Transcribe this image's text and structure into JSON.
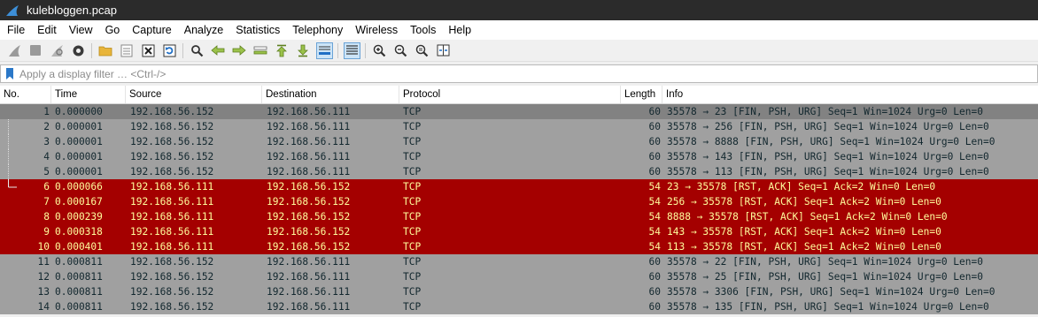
{
  "window": {
    "title": "kulebloggen.pcap",
    "app_icon": "wireshark-fin-icon"
  },
  "menu": [
    "File",
    "Edit",
    "View",
    "Go",
    "Capture",
    "Analyze",
    "Statistics",
    "Telephony",
    "Wireless",
    "Tools",
    "Help"
  ],
  "toolbar": {
    "icons": [
      "start-capture-icon",
      "stop-capture-icon",
      "restart-capture-icon",
      "capture-options-icon",
      "open-file-icon",
      "save-file-icon",
      "close-file-icon",
      "reload-file-icon",
      "find-packet-icon",
      "go-back-icon",
      "go-forward-icon",
      "go-to-packet-icon",
      "go-first-packet-icon",
      "go-last-packet-icon",
      "auto-scroll-icon",
      "colorize-icon",
      "zoom-in-icon",
      "zoom-out-icon",
      "normal-size-icon",
      "resize-columns-icon"
    ]
  },
  "filter": {
    "placeholder": "Apply a display filter … <Ctrl-/>",
    "value": ""
  },
  "columns": [
    "No.",
    "Time",
    "Source",
    "Destination",
    "Protocol",
    "Length",
    "Info"
  ],
  "colors": {
    "tcp_gray": "#a0a0a0",
    "tcp_gray_text": "#12272e",
    "rst_red": "#a40000",
    "rst_red_text": "#fffc9c",
    "selected_gray": "#828282"
  },
  "packets": [
    {
      "no": "1",
      "time": "0.000000",
      "src": "192.168.56.152",
      "dst": "192.168.56.111",
      "proto": "TCP",
      "len": "60",
      "info": "35578 → 23 [FIN, PSH, URG] Seq=1 Win=1024 Urg=0 Len=0",
      "color": "gray",
      "selected": true
    },
    {
      "no": "2",
      "time": "0.000001",
      "src": "192.168.56.152",
      "dst": "192.168.56.111",
      "proto": "TCP",
      "len": "60",
      "info": "35578 → 256 [FIN, PSH, URG] Seq=1 Win=1024 Urg=0 Len=0",
      "color": "gray"
    },
    {
      "no": "3",
      "time": "0.000001",
      "src": "192.168.56.152",
      "dst": "192.168.56.111",
      "proto": "TCP",
      "len": "60",
      "info": "35578 → 8888 [FIN, PSH, URG] Seq=1 Win=1024 Urg=0 Len=0",
      "color": "gray"
    },
    {
      "no": "4",
      "time": "0.000001",
      "src": "192.168.56.152",
      "dst": "192.168.56.111",
      "proto": "TCP",
      "len": "60",
      "info": "35578 → 143 [FIN, PSH, URG] Seq=1 Win=1024 Urg=0 Len=0",
      "color": "gray"
    },
    {
      "no": "5",
      "time": "0.000001",
      "src": "192.168.56.152",
      "dst": "192.168.56.111",
      "proto": "TCP",
      "len": "60",
      "info": "35578 → 113 [FIN, PSH, URG] Seq=1 Win=1024 Urg=0 Len=0",
      "color": "gray"
    },
    {
      "no": "6",
      "time": "0.000066",
      "src": "192.168.56.111",
      "dst": "192.168.56.152",
      "proto": "TCP",
      "len": "54",
      "info": "23 → 35578 [RST, ACK] Seq=1 Ack=2 Win=0 Len=0",
      "color": "red"
    },
    {
      "no": "7",
      "time": "0.000167",
      "src": "192.168.56.111",
      "dst": "192.168.56.152",
      "proto": "TCP",
      "len": "54",
      "info": "256 → 35578 [RST, ACK] Seq=1 Ack=2 Win=0 Len=0",
      "color": "red"
    },
    {
      "no": "8",
      "time": "0.000239",
      "src": "192.168.56.111",
      "dst": "192.168.56.152",
      "proto": "TCP",
      "len": "54",
      "info": "8888 → 35578 [RST, ACK] Seq=1 Ack=2 Win=0 Len=0",
      "color": "red"
    },
    {
      "no": "9",
      "time": "0.000318",
      "src": "192.168.56.111",
      "dst": "192.168.56.152",
      "proto": "TCP",
      "len": "54",
      "info": "143 → 35578 [RST, ACK] Seq=1 Ack=2 Win=0 Len=0",
      "color": "red"
    },
    {
      "no": "10",
      "time": "0.000401",
      "src": "192.168.56.111",
      "dst": "192.168.56.152",
      "proto": "TCP",
      "len": "54",
      "info": "113 → 35578 [RST, ACK] Seq=1 Ack=2 Win=0 Len=0",
      "color": "red"
    },
    {
      "no": "11",
      "time": "0.000811",
      "src": "192.168.56.152",
      "dst": "192.168.56.111",
      "proto": "TCP",
      "len": "60",
      "info": "35578 → 22 [FIN, PSH, URG] Seq=1 Win=1024 Urg=0 Len=0",
      "color": "gray"
    },
    {
      "no": "12",
      "time": "0.000811",
      "src": "192.168.56.152",
      "dst": "192.168.56.111",
      "proto": "TCP",
      "len": "60",
      "info": "35578 → 25 [FIN, PSH, URG] Seq=1 Win=1024 Urg=0 Len=0",
      "color": "gray"
    },
    {
      "no": "13",
      "time": "0.000811",
      "src": "192.168.56.152",
      "dst": "192.168.56.111",
      "proto": "TCP",
      "len": "60",
      "info": "35578 → 3306 [FIN, PSH, URG] Seq=1 Win=1024 Urg=0 Len=0",
      "color": "gray"
    },
    {
      "no": "14",
      "time": "0.000811",
      "src": "192.168.56.152",
      "dst": "192.168.56.111",
      "proto": "TCP",
      "len": "60",
      "info": "35578 → 135 [FIN, PSH, URG] Seq=1 Win=1024 Urg=0 Len=0",
      "color": "gray"
    }
  ]
}
